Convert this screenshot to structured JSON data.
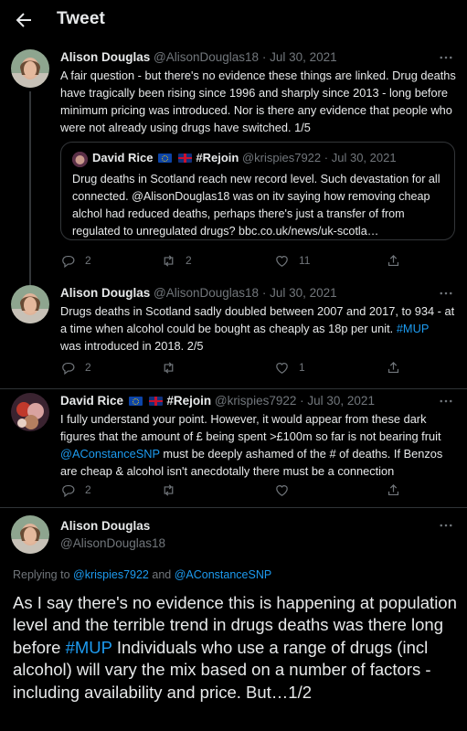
{
  "header": {
    "title": "Tweet",
    "back_icon": "arrow-left-icon"
  },
  "tweets": [
    {
      "name": "Alison Douglas",
      "handle": "@AlisonDouglas18",
      "date": "Jul 30, 2021",
      "dot": "·",
      "body_parts": [
        "A fair question - but there's no evidence these things are linked. Drug deaths have tragically been rising since 1996 and sharply since 2013 - long before minimum pricing was introduced. Nor is there any evidence that people who were not already using drugs have switched. 1/5"
      ],
      "quote": {
        "name": "David Rice",
        "handle": "@krispies7922",
        "date": "Jul 30, 2021",
        "hashtag_name": "#Rejoin",
        "body": "Drug deaths in Scotland reach new record level. Such devastation for all connected. @AlisonDouglas18 was on itv saying how removing cheap alchol had reduced deaths, perhaps there's just a transfer of from regulated to unregulated drugs?  bbc.co.uk/news/uk-scotla…"
      },
      "replies": "2",
      "retweets": "2",
      "likes": "11"
    },
    {
      "name": "Alison Douglas",
      "handle": "@AlisonDouglas18",
      "date": "Jul 30, 2021",
      "dot": "·",
      "body_a": "Drugs deaths in Scotland sadly doubled between 2007 and 2017, to 934 - at a time when alcohol could be bought as cheaply as 18p per unit. ",
      "body_link": "#MUP",
      "body_b": "was introduced in 2018. 2/5",
      "replies": "2",
      "retweets": "",
      "likes": "1"
    },
    {
      "name": "David Rice",
      "hashtag_name": "#Rejoin",
      "handle": "@krispies7922",
      "date": "Jul 30, 2021",
      "dot": "·",
      "body_a": "I fully understand your point. However, it would appear from these dark figures that the amount of £ being spent >£100m so far is not bearing fruit ",
      "body_link": "@AConstanceSNP",
      "body_b": " must be deeply ashamed of the # of deaths. If Benzos are cheap & alcohol isn't anecdotally there must be a connection",
      "replies": "2",
      "retweets": "",
      "likes": ""
    }
  ],
  "main_tweet": {
    "name": "Alison Douglas",
    "handle": "@AlisonDouglas18",
    "replying_prefix": "Replying to ",
    "replying_user1": "@krispies7922",
    "replying_and": " and ",
    "replying_user2": "@AConstanceSNP",
    "body_a": "As I say there's no evidence this is happening at population level and the terrible trend in drugs deaths was there long before ",
    "body_link": "#MUP",
    "body_b": " Individuals who use a range of drugs (incl alcohol) will vary the mix based on a number of factors -  including availability and price. But…1/2"
  },
  "colors": {
    "background": "#000000",
    "text": "#e7e9ea",
    "muted": "#71767b",
    "link": "#1d9bf0"
  }
}
